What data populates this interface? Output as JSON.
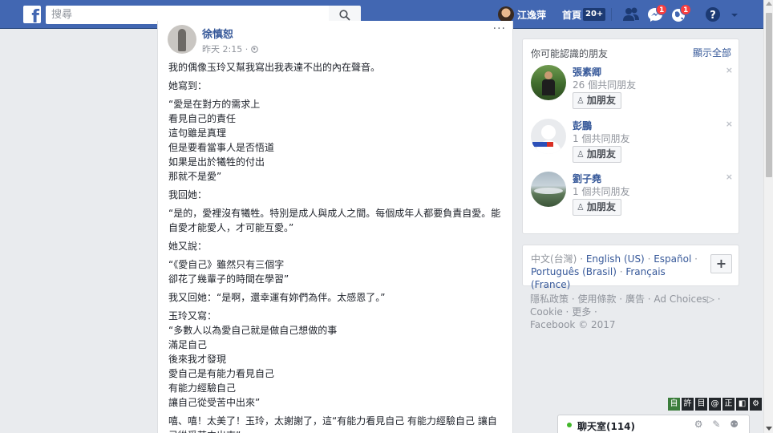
{
  "topbar": {
    "logo_letter": "f",
    "search_placeholder": "搜尋",
    "user_name": "江逸萍",
    "home_label": "首頁",
    "home_count": "20+",
    "messages_badge": "1",
    "notifications_badge": "1",
    "brand_color": "#4267b2"
  },
  "post": {
    "author": "徐慎恕",
    "time": "昨天 2:15 · ",
    "menu": "···",
    "paragraphs": [
      "我的偶像玉玲又幫我寫出我表達不出的內在聲音。",
      "她寫到：",
      "“愛是在對方的需求上\n看見自己的責任\n這句雖是真理\n但是要看當事人是否悟道\n如果是出於犧牲的付出\n那就不是愛”",
      "我回她：",
      "“是的，愛裡沒有犧牲。特別是成人與成人之間。每個成年人都要負責自愛。能自愛才能愛人，才可能互愛。”",
      "她又說：",
      "“《愛自己》雖然只有三個字\n卻花了幾輩子的時間在學習”",
      "我又回她：“是啊，還幸運有妳們為伴。太感恩了。”",
      "玉玲又寫：\n“多數人以為愛自己就是做自己想做的事\n滿足自己\n後來我才發現\n愛自己是有能力看見自己\n有能力經驗自己\n讓自己從受苦中出來”",
      "嘻、嘻！太美了！玉玲，太謝謝了，這“有能力看見自己 有能力經驗自己 讓自己從受苦中出來”"
    ]
  },
  "friends": {
    "title": "你可能認識的朋友",
    "see_all": "顯示全部",
    "items": [
      {
        "name": "張素卿",
        "mutual": "26 個共同朋友",
        "add_label": "加朋友"
      },
      {
        "name": "彭鵬",
        "mutual": "1 個共同朋友",
        "add_label": "加朋友"
      },
      {
        "name": "劉子堯",
        "mutual": "1 個共同朋友",
        "add_label": "加朋友"
      }
    ],
    "close_glyph": "×"
  },
  "languages": {
    "current": "中文(台灣)",
    "options": [
      "English (US)",
      "Español",
      "Português (Brasil)",
      "Français (France)"
    ],
    "sep": " · ",
    "more": "+"
  },
  "footer": {
    "links": [
      "隱私政策",
      "使用條款",
      "廣告",
      "Ad Choices",
      "Cookie",
      "更多"
    ],
    "copyright": "Facebook © 2017"
  },
  "mini_toolbar": [
    "自",
    "許",
    "目",
    "@",
    "正",
    "◧",
    "⚙"
  ],
  "chat": {
    "label": "聊天室(114)",
    "icons": "⚙ ✎ ⚉"
  }
}
